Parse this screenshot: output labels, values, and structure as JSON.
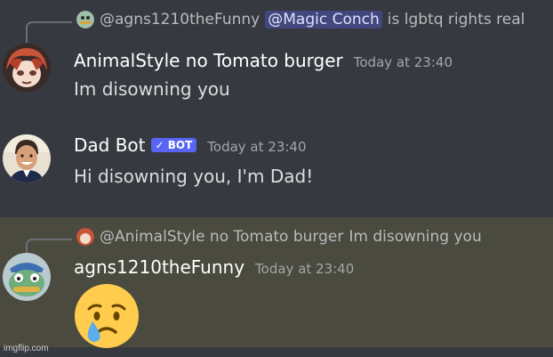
{
  "messages": [
    {
      "reply": {
        "author": "@agns1210theFunny",
        "mention": "@Magic Conch",
        "text": "is lgbtq rights real"
      },
      "author": "AnimalStyle no Tomato burger",
      "timestamp": "Today at 23:40",
      "content": "Im disowning you"
    },
    {
      "author": "Dad Bot",
      "bot_tag": "✓ BOT",
      "timestamp": "Today at 23:40",
      "content": "Hi disowning you, I'm Dad!"
    },
    {
      "reply": {
        "author": "@AnimalStyle no Tomato burger",
        "text": "Im disowning you"
      },
      "author": "agns1210theFunny",
      "timestamp": "Today at 23:40",
      "emoji": "sad-but-relieved-face"
    }
  ],
  "watermark": "imgflip.com",
  "colors": {
    "background": "#36393f",
    "highlight": "#4b4a3f",
    "mention_bg": "#5865f2",
    "bot_tag": "#5865f2"
  }
}
